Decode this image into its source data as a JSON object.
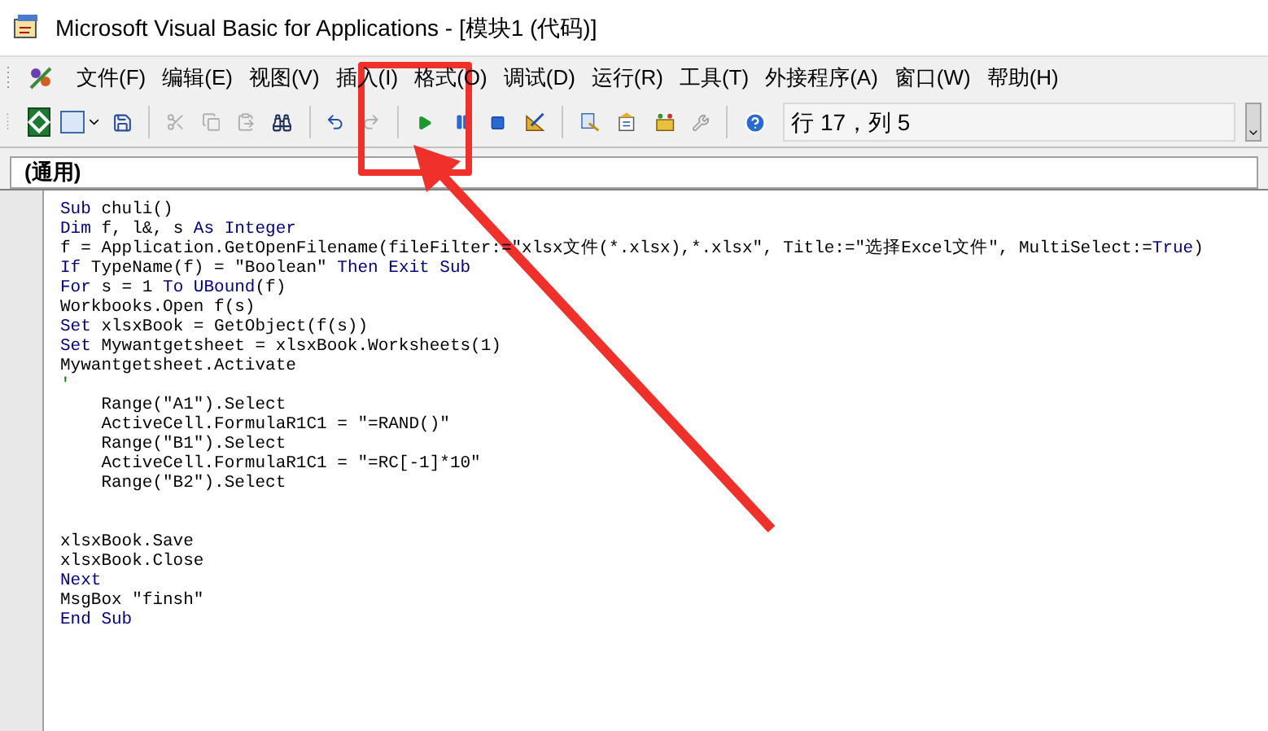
{
  "window": {
    "title": "Microsoft Visual Basic for Applications - [模块1 (代码)]"
  },
  "menu": [
    "文件(F)",
    "编辑(E)",
    "视图(V)",
    "插入(I)",
    "格式(O)",
    "调试(D)",
    "运行(R)",
    "工具(T)",
    "外接程序(A)",
    "窗口(W)",
    "帮助(H)"
  ],
  "toolbar": {
    "position": "行 17，列 5"
  },
  "object_box": "(通用)",
  "code": [
    {
      "kind": "code",
      "segments": [
        {
          "kind": "keyword",
          "text": "Sub"
        },
        {
          "kind": "plain",
          "text": " chuli()"
        }
      ]
    },
    {
      "kind": "code",
      "segments": [
        {
          "kind": "keyword",
          "text": "Dim"
        },
        {
          "kind": "plain",
          "text": " f, l&, s "
        },
        {
          "kind": "keyword",
          "text": "As Integer"
        }
      ]
    },
    {
      "kind": "code",
      "segments": [
        {
          "kind": "plain",
          "text": "f = Application.GetOpenFilename(fileFilter:=\"xlsx文件(*.xlsx),*.xlsx\", Title:=\"选择Excel文件\", MultiSelect:="
        },
        {
          "kind": "keyword",
          "text": "True"
        },
        {
          "kind": "plain",
          "text": ")"
        }
      ]
    },
    {
      "kind": "code",
      "segments": [
        {
          "kind": "keyword",
          "text": "If"
        },
        {
          "kind": "plain",
          "text": " TypeName(f) = \"Boolean\" "
        },
        {
          "kind": "keyword",
          "text": "Then Exit Sub"
        }
      ]
    },
    {
      "kind": "code",
      "segments": [
        {
          "kind": "keyword",
          "text": "For"
        },
        {
          "kind": "plain",
          "text": " s = 1 "
        },
        {
          "kind": "keyword",
          "text": "To UBound"
        },
        {
          "kind": "plain",
          "text": "(f)"
        }
      ]
    },
    {
      "kind": "code",
      "segments": [
        {
          "kind": "plain",
          "text": "Workbooks.Open f(s)"
        }
      ]
    },
    {
      "kind": "code",
      "segments": [
        {
          "kind": "keyword",
          "text": "Set"
        },
        {
          "kind": "plain",
          "text": " xlsxBook = GetObject(f(s))"
        }
      ]
    },
    {
      "kind": "code",
      "segments": [
        {
          "kind": "keyword",
          "text": "Set"
        },
        {
          "kind": "plain",
          "text": " Mywantgetsheet = xlsxBook.Worksheets(1)"
        }
      ]
    },
    {
      "kind": "code",
      "segments": [
        {
          "kind": "plain",
          "text": "Mywantgetsheet.Activate"
        }
      ]
    },
    {
      "kind": "code",
      "segments": [
        {
          "kind": "comment",
          "text": "'"
        }
      ]
    },
    {
      "kind": "code",
      "segments": [
        {
          "kind": "plain",
          "text": "    Range(\"A1\").Select"
        }
      ]
    },
    {
      "kind": "code",
      "segments": [
        {
          "kind": "plain",
          "text": "    ActiveCell.FormulaR1C1 = \"=RAND()\""
        }
      ]
    },
    {
      "kind": "code",
      "segments": [
        {
          "kind": "plain",
          "text": "    Range(\"B1\").Select"
        }
      ]
    },
    {
      "kind": "code",
      "segments": [
        {
          "kind": "plain",
          "text": "    ActiveCell.FormulaR1C1 = \"=RC[-1]*10\""
        }
      ]
    },
    {
      "kind": "code",
      "segments": [
        {
          "kind": "plain",
          "text": "    Range(\"B2\").Select"
        }
      ]
    },
    {
      "kind": "blank"
    },
    {
      "kind": "blank"
    },
    {
      "kind": "code",
      "segments": [
        {
          "kind": "plain",
          "text": "xlsxBook.Save"
        }
      ]
    },
    {
      "kind": "code",
      "segments": [
        {
          "kind": "plain",
          "text": "xlsxBook.Close"
        }
      ]
    },
    {
      "kind": "code",
      "segments": [
        {
          "kind": "keyword",
          "text": "Next"
        }
      ]
    },
    {
      "kind": "code",
      "segments": [
        {
          "kind": "plain",
          "text": "MsgBox \"finsh\""
        }
      ]
    },
    {
      "kind": "code",
      "segments": [
        {
          "kind": "keyword",
          "text": "End Sub"
        }
      ]
    }
  ]
}
